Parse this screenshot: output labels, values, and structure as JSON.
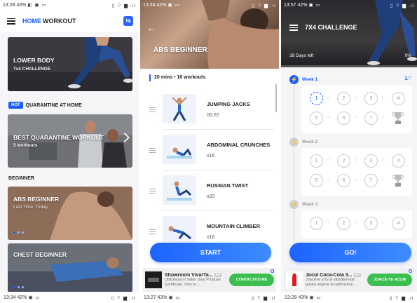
{
  "screen1": {
    "status": {
      "time": "13:28",
      "battery": "43%",
      "icons": "◧ ▣ ▭",
      "right": "▯ ⌔ ▆ .ıl"
    },
    "header": {
      "title_blue": "HOME",
      "title_dark": "WORKOUT",
      "kg_icon": "kg-icon"
    },
    "lower_body_card": {
      "title": "LOWER BODY",
      "subtitle": "7x4 CHALLENGE"
    },
    "hot_badge": "HOT",
    "quarantine_label": "QUARANTINE AT HOME",
    "quarantine_card": {
      "title": "BEST QUARANTINE WORKOUT",
      "subtitle": "5 workouts"
    },
    "beginner_label": "BEGINNER",
    "abs_card": {
      "title": "ABS BEGINNER",
      "subtitle": "Last Time: Today"
    },
    "chest_card": {
      "title": "CHEST BEGINNER"
    },
    "bottom_status": {
      "time": "13:34",
      "battery": "42%",
      "icons": "▣ ▭",
      "right": "▯ ⌔ ▆ .ıl"
    }
  },
  "screen2": {
    "status": {
      "time": "13:34",
      "battery": "42%",
      "icons": "▣ ▭",
      "right": "▯ ⌔ ▆ .ıl"
    },
    "title": "ABS BEGINNER",
    "summary": "20 mins • 16 workouts",
    "exercises": [
      {
        "name": "JUMPING JACKS",
        "detail": "00:20"
      },
      {
        "name": "ABDOMINAL CRUNCHES",
        "detail": "x16"
      },
      {
        "name": "RUSSIAN TWIST",
        "detail": "x20"
      },
      {
        "name": "MOUNTAIN CLIMBER",
        "detail": "x16"
      }
    ],
    "start_button": "START",
    "ad": {
      "title": "Showroom VivarTa...",
      "tag": "Ad",
      "body": "Utilizeaza in Salon doar Produse Certificate. Vino in ...",
      "cta": "CONTACTAȚI-NE"
    },
    "bottom_status": {
      "time": "13:27",
      "battery": "43%",
      "icons": "▣ ▭",
      "right": "▯ ⌔ ▆ .ıl"
    }
  },
  "screen3": {
    "status": {
      "time": "13:57",
      "battery": "42%",
      "icons": "▣ ▭",
      "right": "▯ ⌔ ▆ .ıl"
    },
    "title": "7X4 CHALLENGE",
    "days_left": "28 Days left",
    "progress_pct": "0%",
    "progress_value": 0,
    "weeks": [
      {
        "label": "Week 1",
        "done": "1",
        "total": "/7",
        "active": true
      },
      {
        "label": "Week 2",
        "active": false
      },
      {
        "label": "Week 3",
        "active": false
      }
    ],
    "days_row1": [
      "1",
      "2",
      "3",
      "4"
    ],
    "days_row2": [
      "5",
      "6",
      "7"
    ],
    "go_button": "GO!",
    "ad": {
      "title": "Jocul Coca-Cola 3...",
      "tag": "Ad",
      "body": "Joacă-te și tu și sărbătorește gustul original al optimismul...",
      "cta": "JOACĂ-TE ACUM"
    },
    "bottom_status": {
      "time": "13:28",
      "battery": "43%",
      "icons": "▣ ▭",
      "right": "▯ ⌔ ▆ .ıl"
    }
  },
  "colors": {
    "accent": "#1a5cff",
    "cta_green": "#3bbf4e"
  }
}
